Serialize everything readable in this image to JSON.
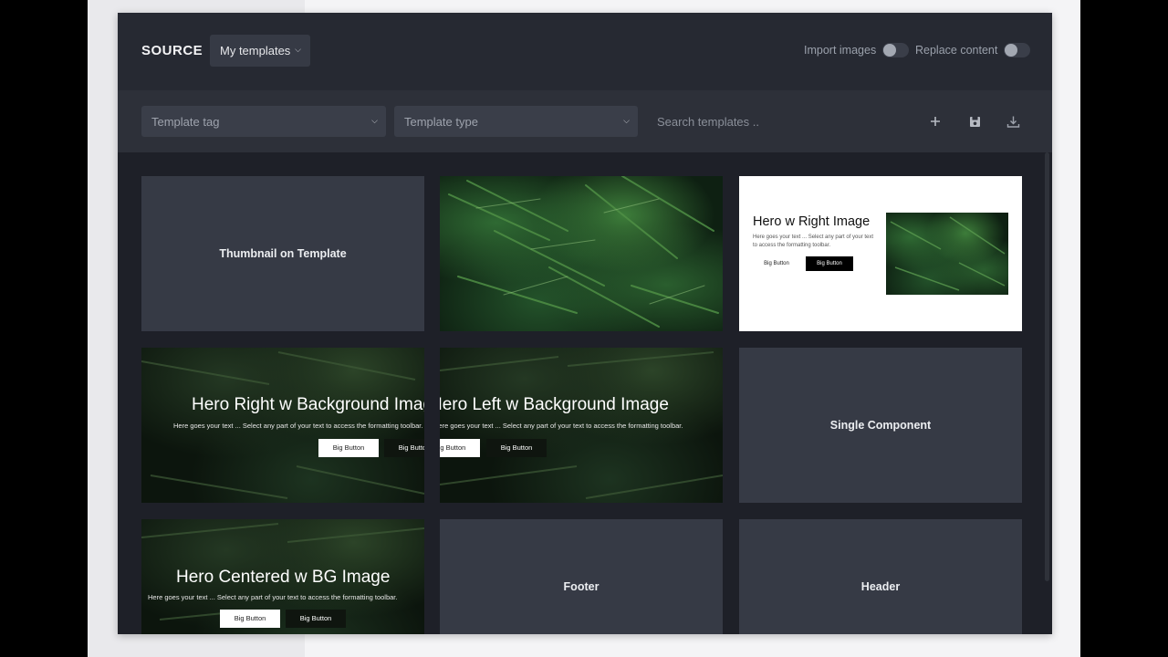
{
  "header": {
    "source_label": "SOURCE",
    "source_select": "My templates",
    "import_images_label": "Import images",
    "replace_content_label": "Replace content"
  },
  "filters": {
    "template_tag_placeholder": "Template tag",
    "template_type_placeholder": "Template type",
    "search_placeholder": "Search templates ..",
    "add_icon": "plus-icon",
    "save_icon": "save-icon",
    "download_icon": "download-icon"
  },
  "cards": {
    "thumbnail_title": "Thumbnail on Template",
    "hero_right_image": {
      "title": "Hero w Right Image",
      "text": "Here goes your text ... Select any part of your text to access the formatting toolbar.",
      "button1": "Big Button",
      "button2": "Big Button"
    },
    "hero_right_bg": {
      "title": "Hero Right w Background Image",
      "text": "Here goes your text ... Select any part of your text to access the formatting toolbar.",
      "button1": "Big Button",
      "button2": "Big Button"
    },
    "hero_left_bg": {
      "title": "Hero Left w Background Image",
      "text": "Here goes your text ... Select any part of your text to access the formatting toolbar.",
      "button1": "Big Button",
      "button2": "Big Button"
    },
    "single_component_title": "Single Component",
    "hero_centered_bg": {
      "title": "Hero Centered w BG Image",
      "text": "Here goes your text ... Select any part of your text to access the formatting toolbar.",
      "button1": "Big Button",
      "button2": "Big Button"
    },
    "footer_title": "Footer",
    "header_title": "Header"
  },
  "colors": {
    "modal_bg": "#1e2028",
    "card_bg": "#363a45",
    "accent_green": "#2f6a33"
  }
}
